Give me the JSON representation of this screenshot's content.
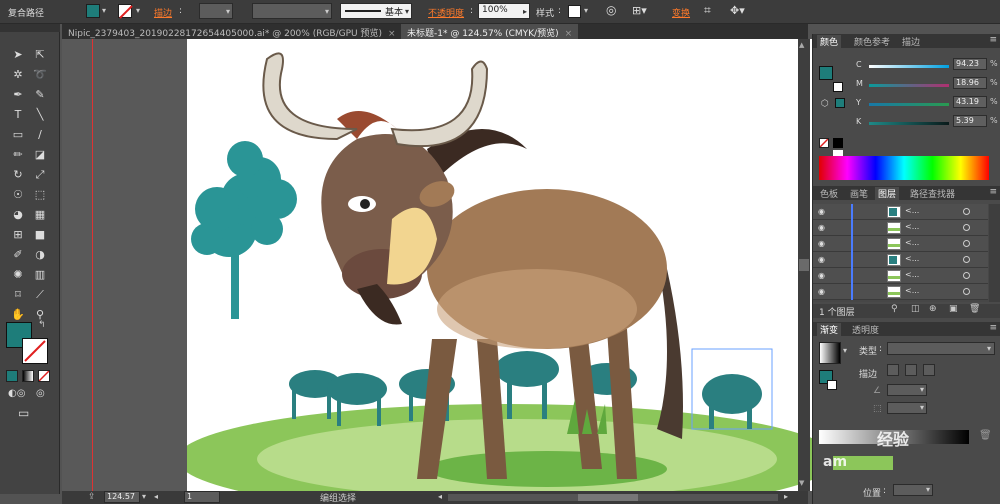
{
  "control_bar": {
    "object_type": "复合路径",
    "stroke_label": "描边",
    "stroke_colon": ":",
    "brush_label": "基本",
    "opacity_label": "不透明度",
    "opacity_colon": ":",
    "opacity_value": "100%",
    "style_label": "样式",
    "style_colon": ":",
    "transform_label": "变换",
    "fill_color": "#1e7d7a"
  },
  "doc_tabs": [
    {
      "label": "Nipic_2379403_20190228172654405000.ai* @ 200% (RGB/GPU 预览)",
      "close": "×"
    },
    {
      "label": "未标题-1* @ 124.57% (CMYK/预览)",
      "close": "×"
    }
  ],
  "status_bar": {
    "zoom": "124.57",
    "artboard": "1",
    "tool_name": "编组选择"
  },
  "color_panel": {
    "tabs": [
      "颜色",
      "颜色参考",
      "描边"
    ],
    "channels": [
      {
        "key": "C",
        "value": "94.23",
        "unit": "%"
      },
      {
        "key": "M",
        "value": "18.96",
        "unit": "%"
      },
      {
        "key": "Y",
        "value": "43.19",
        "unit": "%"
      },
      {
        "key": "K",
        "value": "5.39",
        "unit": "%"
      }
    ]
  },
  "layers_panel": {
    "tabs": [
      "色板",
      "画笔",
      "图层",
      "路径查找器"
    ],
    "rows": [
      {
        "name": "<..."
      },
      {
        "name": "<..."
      },
      {
        "name": "<..."
      },
      {
        "name": "<..."
      },
      {
        "name": "<..."
      },
      {
        "name": "<..."
      }
    ],
    "footer": "1 个图层"
  },
  "gradient_panel": {
    "tabs": [
      "渐变",
      "透明度"
    ],
    "type_label": "类型",
    "type_colon": ":",
    "stroke_label": "描边",
    "position_label": "位置",
    "position_colon": ":"
  },
  "watermark": {
    "text1": "经验",
    "text2": "am"
  },
  "colors": {
    "teal": "#1e7d7a",
    "highlight": "#ff7a2a",
    "grass": "#8cc65a"
  }
}
